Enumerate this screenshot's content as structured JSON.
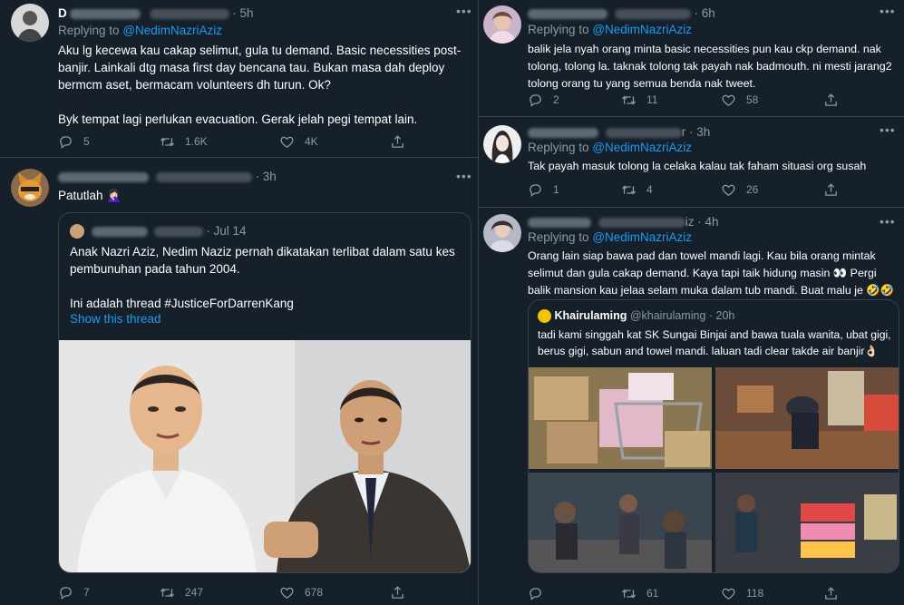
{
  "left": {
    "tweet1": {
      "time": "· 5h",
      "replying_prefix": "Replying to",
      "replying_handle": "@NedimNazriAziz",
      "text": "Aku lg kecewa kau cakap selimut, gula tu demand. Basic necessities post-banjir. Lainkali dtg masa first day bencana tau. Bukan masa dah deploy bermcm aset, bermacam volunteers dh turun. Ok?\n\nByk tempat lagi perlukan evacuation. Gerak jelah pegi tempat lain.",
      "replies": "5",
      "retweets": "1.6K",
      "likes": "4K"
    },
    "tweet2": {
      "time": "· 3h",
      "text": "Patutlah 🤦🏻‍♀️",
      "quote": {
        "date": "· Jul 14",
        "text": "Anak Nazri Aziz, Nedim Naziz pernah dikatakan terlibat dalam satu kes pembunuhan pada tahun 2004.\n\nIni adalah thread #JusticeForDarrenKang",
        "show_thread": "Show this thread"
      },
      "replies": "7",
      "retweets": "247",
      "likes": "678"
    }
  },
  "right": {
    "tweet1": {
      "time": "· 6h",
      "replying_prefix": "Replying to",
      "replying_handle": "@NedimNazriAziz",
      "text": "balik jela nyah orang minta basic necessities pun kau ckp demand. nak tolong, tolong la. taknak tolong tak payah nak badmouth. ni mesti jarang2 tolong orang tu yang semua benda nak tweet.",
      "replies": "2",
      "retweets": "11",
      "likes": "58"
    },
    "tweet2": {
      "name_suffix": "r",
      "time": "· 3h",
      "replying_prefix": "Replying to",
      "replying_handle": "@NedimNazriAziz",
      "text": "Tak payah masuk tolong la celaka kalau tak faham situasi org susah",
      "replies": "1",
      "retweets": "4",
      "likes": "26"
    },
    "tweet3": {
      "name_suffix": "iz",
      "time": "· 4h",
      "replying_prefix": "Replying to",
      "replying_handle": "@NedimNazriAziz",
      "text": "Orang lain siap bawa pad dan towel mandi lagi. Kau bila orang mintak selimut dan gula cakap demand. Kaya tapi taik hidung masin 👀 Pergi balik mansion kau jelaa selam muka dalam tub mandi. Buat malu je 🤣🤣",
      "quote": {
        "name": "Khairulaming",
        "handle": "@khairulaming",
        "time": "· 20h",
        "text": "tadi kami singgah kat SK Sungai Binjai and bawa tuala wanita, ubat gigi, berus gigi, sabun and towel mandi. laluan tadi clear takde air banjir👌🏻"
      },
      "replies": "",
      "retweets": "61",
      "likes": "118"
    }
  },
  "icons": {
    "reply": "reply-icon",
    "retweet": "retweet-icon",
    "like": "heart-icon",
    "share": "share-icon",
    "more": "more-icon"
  },
  "colors": {
    "background": "#15202b",
    "border": "#38444d",
    "muted": "#8b98a5",
    "accent": "#1d9bf0"
  }
}
